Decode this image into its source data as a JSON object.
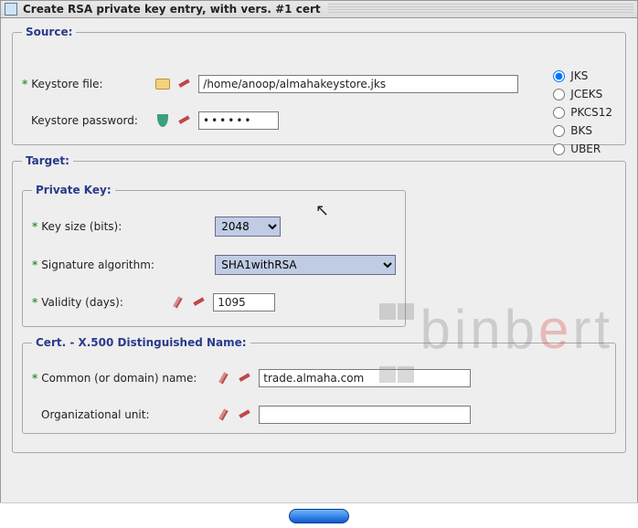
{
  "window": {
    "title": "Create RSA private key entry, with vers. #1 cert"
  },
  "source": {
    "legend": "Source:",
    "keystore_file_label": "Keystore file:",
    "keystore_file_value": "/home/anoop/almahakeystore.jks",
    "keystore_password_label": "Keystore password:",
    "keystore_password_value": "••••••",
    "types": {
      "jks": "JKS",
      "jceks": "JCEKS",
      "pkcs12": "PKCS12",
      "bks": "BKS",
      "uber": "UBER",
      "selected": "jks"
    }
  },
  "target": {
    "legend": "Target:",
    "private_key_legend": "Private Key:",
    "key_size_label": "Key size (bits):",
    "key_size_value": "2048",
    "sig_alg_label": "Signature algorithm:",
    "sig_alg_value": "SHA1withRSA",
    "validity_label": "Validity (days):",
    "validity_value": "1095",
    "dn_legend": "Cert. - X.500 Distinguished Name:",
    "cn_label": "Common (or domain) name:",
    "cn_value": "trade.almaha.com",
    "ou_label": "Organizational unit:"
  },
  "watermark": {
    "text_a": "binb",
    "text_e": "e",
    "text_b": "rt"
  }
}
